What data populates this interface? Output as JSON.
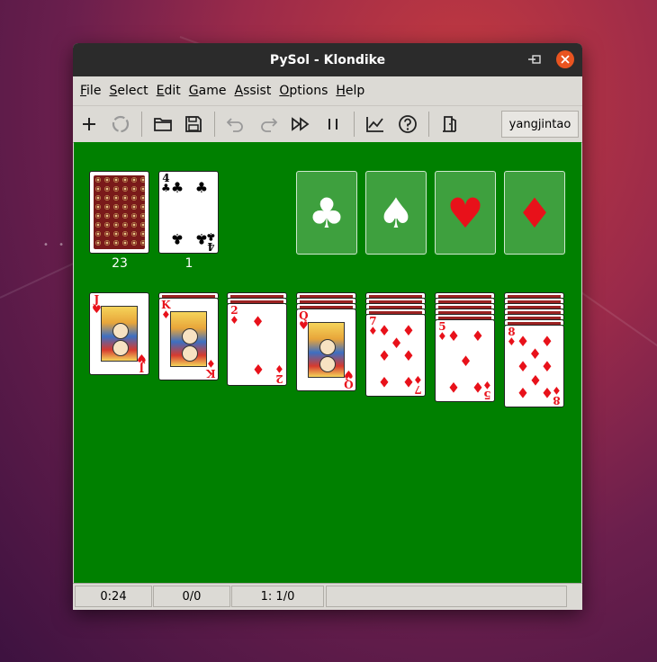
{
  "window": {
    "title": "PySol - Klondike",
    "close_icon": "×",
    "min_icon": "–",
    "max_icon": "□"
  },
  "menu": [
    {
      "label": "File",
      "mnemonic": "F",
      "rest": "ile"
    },
    {
      "label": "Select",
      "mnemonic": "S",
      "rest": "elect"
    },
    {
      "label": "Edit",
      "mnemonic": "E",
      "rest": "dit"
    },
    {
      "label": "Game",
      "mnemonic": "G",
      "rest": "ame"
    },
    {
      "label": "Assist",
      "mnemonic": "A",
      "rest": "ssist"
    },
    {
      "label": "Options",
      "mnemonic": "O",
      "rest": "ptions"
    },
    {
      "label": "Help",
      "mnemonic": "H",
      "rest": "elp"
    }
  ],
  "toolbar": {
    "buttons": [
      "new-game",
      "restart",
      "open",
      "save",
      "undo",
      "redo",
      "autodrop",
      "pause",
      "statistics",
      "rules",
      "quit"
    ],
    "player": "yangjintao"
  },
  "table": {
    "background": "#008000",
    "stock": {
      "count": "23"
    },
    "waste": {
      "count": "1",
      "top": {
        "rank": "4",
        "suit": "♣",
        "color": "black"
      }
    },
    "foundations": [
      {
        "suit": "♣",
        "color": "#ffffff"
      },
      {
        "suit": "♠",
        "color": "#ffffff"
      },
      {
        "suit": "♥",
        "color": "#e8111a"
      },
      {
        "suit": "♦",
        "color": "#e8111a"
      }
    ],
    "tableau": [
      {
        "hidden": 0,
        "top": {
          "rank": "J",
          "suit": "♥",
          "color": "red"
        }
      },
      {
        "hidden": 1,
        "top": {
          "rank": "K",
          "suit": "♦",
          "color": "red"
        }
      },
      {
        "hidden": 2,
        "top": {
          "rank": "2",
          "suit": "♦",
          "color": "red"
        }
      },
      {
        "hidden": 3,
        "top": {
          "rank": "Q",
          "suit": "♥",
          "color": "red"
        }
      },
      {
        "hidden": 4,
        "top": {
          "rank": "7",
          "suit": "♦",
          "color": "red"
        }
      },
      {
        "hidden": 5,
        "top": {
          "rank": "5",
          "suit": "♦",
          "color": "red"
        }
      },
      {
        "hidden": 6,
        "top": {
          "rank": "8",
          "suit": "♦",
          "color": "red"
        }
      }
    ]
  },
  "status": {
    "time": "0:24",
    "moves": "0/0",
    "score": "1: 1/0",
    "message": ""
  }
}
